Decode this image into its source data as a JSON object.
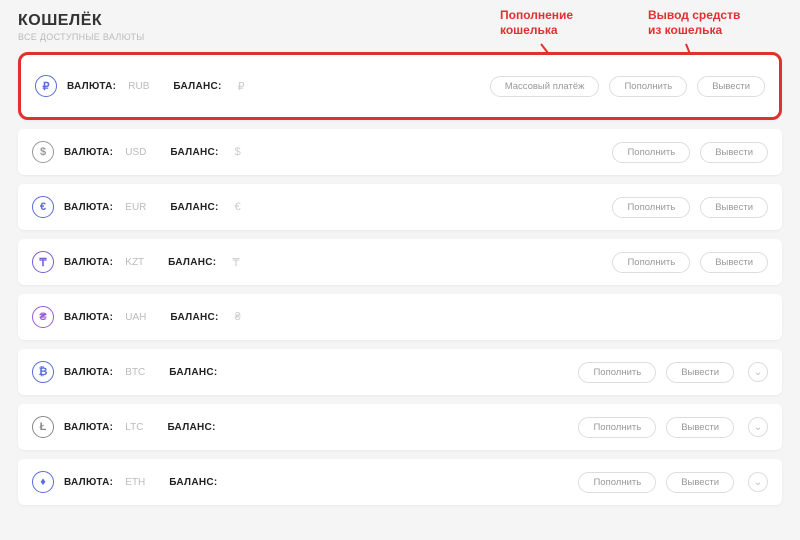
{
  "header": {
    "title": "КОШЕЛЁК",
    "subtitle": "ВСЕ ДОСТУПНЫЕ ВАЛЮТЫ"
  },
  "annotations": {
    "deposit": "Пополнение\nкошелька",
    "withdraw": "Вывод средств\nиз кошелька"
  },
  "labels": {
    "currency": "ВАЛЮТА:",
    "balance": "БАЛАНС:",
    "mass_pay": "Массовый платёж",
    "deposit": "Пополнить",
    "withdraw": "Вывести"
  },
  "rows": [
    {
      "code": "RUB",
      "symbol": "₽",
      "icon": "₽",
      "color": "#5a6bdb",
      "highlighted": true,
      "mass_pay": true,
      "chevron": false
    },
    {
      "code": "USD",
      "symbol": "$",
      "icon": "$",
      "color": "#999",
      "highlighted": false,
      "mass_pay": false,
      "chevron": false
    },
    {
      "code": "EUR",
      "symbol": "€",
      "icon": "€",
      "color": "#5a6bdb",
      "highlighted": false,
      "mass_pay": false,
      "chevron": false
    },
    {
      "code": "KZT",
      "symbol": "₸",
      "icon": "₸",
      "color": "#7a5bd6",
      "highlighted": false,
      "mass_pay": false,
      "chevron": false
    },
    {
      "code": "UAH",
      "symbol": "₴",
      "icon": "₴",
      "color": "#9a5bd6",
      "highlighted": false,
      "mass_pay": false,
      "chevron": false,
      "no_buttons": true
    },
    {
      "code": "BTC",
      "symbol": "",
      "icon": "₿",
      "color": "#5a6bdb",
      "highlighted": false,
      "mass_pay": false,
      "chevron": true
    },
    {
      "code": "LTC",
      "symbol": "",
      "icon": "Ł",
      "color": "#888",
      "highlighted": false,
      "mass_pay": false,
      "chevron": true
    },
    {
      "code": "ETH",
      "symbol": "",
      "icon": "♦",
      "color": "#5a6bdb",
      "highlighted": false,
      "mass_pay": false,
      "chevron": true
    }
  ]
}
